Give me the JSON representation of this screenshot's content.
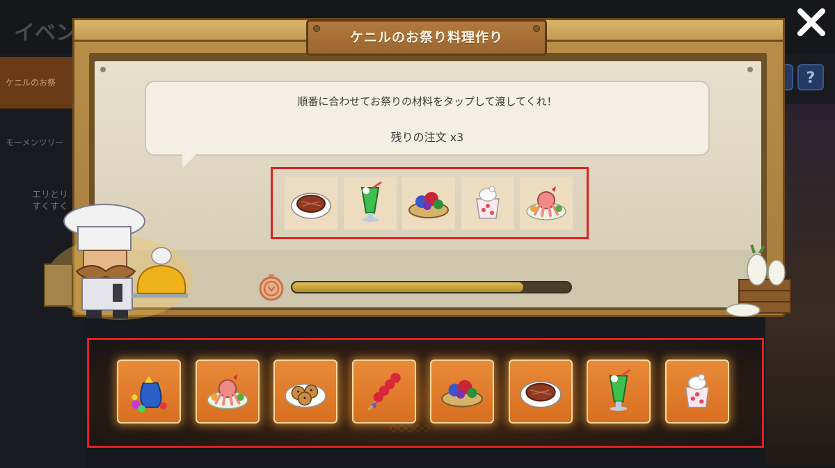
{
  "window": {
    "title": "ケニルのお祭り料理作り"
  },
  "background": {
    "header_title": "イベン",
    "sidebar_items": [
      "ケニルのお祭",
      "モーメンツリー",
      "エリとリ\nすくすく"
    ],
    "help_buttons": [
      "?",
      "?"
    ],
    "bottom_text": "◇◇◇◇◇"
  },
  "dialog": {
    "instruction": "順番に合わせてお祭りの材料をタップして渡してくれ！",
    "remaining_orders": "残りの注文 x3"
  },
  "order": {
    "items": [
      "steak-icon",
      "melon-soda-icon",
      "grape-cake-icon",
      "parfait-icon",
      "octopus-sausage-icon"
    ]
  },
  "timer": {
    "remaining_fraction": 0.83
  },
  "tray": {
    "items": [
      "candy-bag-icon",
      "octopus-sausage-icon",
      "cookies-icon",
      "candied-fruit-skewer-icon",
      "grape-cake-icon",
      "steak-icon",
      "melon-soda-icon",
      "parfait-icon"
    ]
  },
  "colors": {
    "highlight_border": "#e0211d",
    "ingredient_button": "#e07b2c",
    "timer_fill": "#d4b04a"
  }
}
